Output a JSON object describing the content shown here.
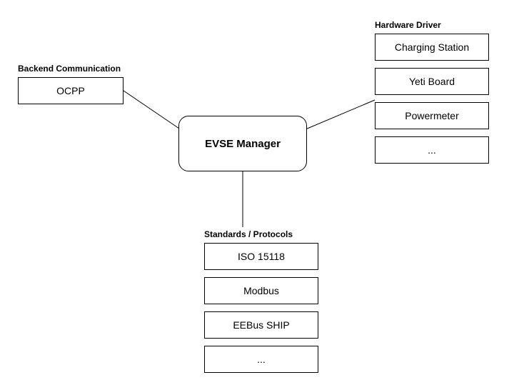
{
  "center": {
    "label": "EVSE Manager"
  },
  "backend": {
    "title": "Backend Communication",
    "items": [
      "OCPP"
    ]
  },
  "hardware": {
    "title": "Hardware Driver",
    "items": [
      "Charging Station",
      "Yeti Board",
      "Powermeter",
      "..."
    ]
  },
  "standards": {
    "title": "Standards / Protocols",
    "items": [
      "ISO 15118",
      "Modbus",
      "EEBus SHIP",
      "..."
    ]
  }
}
